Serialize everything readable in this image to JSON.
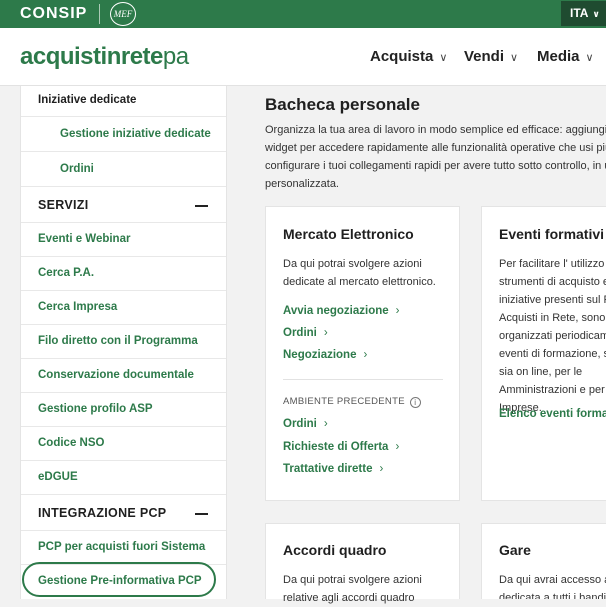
{
  "topbar": {
    "consip_logo": "CONSIP",
    "mef_logo": "MEF",
    "language": "ITA"
  },
  "header": {
    "brand_main": "acquistinrete",
    "brand_suffix": "pa",
    "nav": [
      "Acquista",
      "Vendi",
      "Media"
    ]
  },
  "sidebar": {
    "top_item": "Iniziative dedicate",
    "sub_items": [
      "Gestione iniziative dedicate",
      "Ordini"
    ],
    "section_servizi": "SERVIZI",
    "servizi": [
      "Eventi e Webinar",
      "Cerca P.A.",
      "Cerca Impresa",
      "Filo diretto con il Programma",
      "Conservazione documentale",
      "Gestione profilo ASP",
      "Codice NSO",
      "eDGUE"
    ],
    "section_pcp": "INTEGRAZIONE PCP",
    "pcp": [
      "PCP per acquisti fuori Sistema",
      "Gestione Pre-informativa PCP"
    ]
  },
  "main": {
    "title": "Bacheca personale",
    "desc": [
      "Organizza la tua area di lavoro in modo semplice ed efficace: aggiungi, r",
      "widget per accedere rapidamente alle funzionalità operative che usi più",
      "configurare i tuoi collegamenti rapidi per avere tutto sotto controllo, in un",
      "personalizzata."
    ]
  },
  "cards": {
    "mercato": {
      "title": "Mercato Elettronico",
      "text": [
        "Da qui potrai svolgere azioni",
        "dedicate al mercato elettronico."
      ],
      "links": [
        "Avvia negoziazione",
        "Ordini",
        "Negoziazione"
      ],
      "env_label": "AMBIENTE PRECEDENTE",
      "env_links": [
        "Ordini",
        "Richieste di Offerta",
        "Trattative dirette"
      ]
    },
    "eventi": {
      "title": "Eventi formativi",
      "text": [
        "Per facilitare l' utilizzo d",
        "strumenti di acquisto e",
        "iniziative presenti sul P",
        "Acquisti in Rete, sono",
        "organizzati periodicam",
        "eventi di formazione, s",
        "sia on line, per le",
        "Amministrazioni e per",
        "Imprese."
      ],
      "link": "Elenco eventi format"
    },
    "accordi": {
      "title": "Accordi quadro",
      "text": [
        "Da qui potrai svolgere azioni",
        "relative agli accordi quadro"
      ]
    },
    "gare": {
      "title": "Gare",
      "text": [
        "Da qui avrai accesso a",
        "dedicata a tutti i bandi"
      ]
    }
  }
}
